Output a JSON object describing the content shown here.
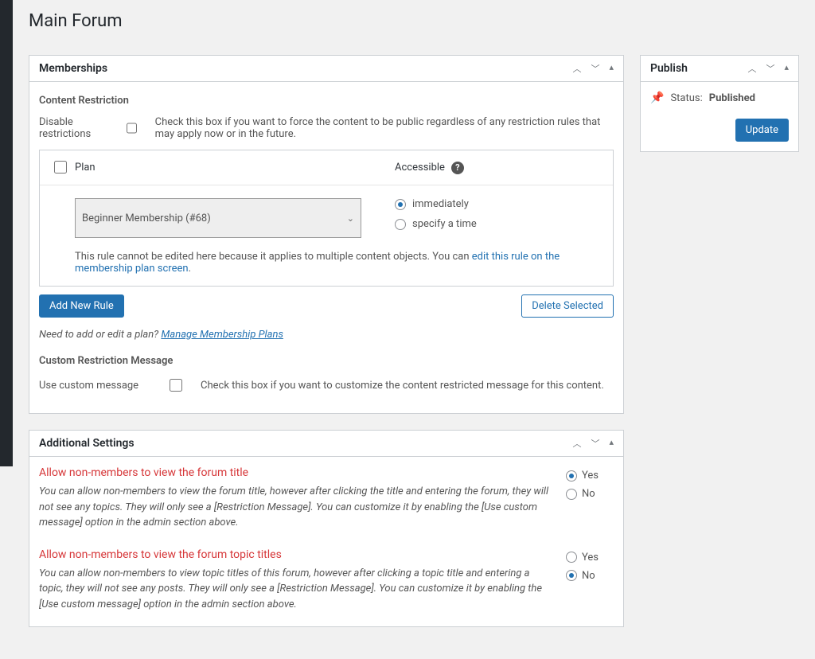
{
  "page": {
    "title": "Main Forum"
  },
  "memberships": {
    "box_title": "Memberships",
    "content_restriction_heading": "Content Restriction",
    "disable_label": "Disable restrictions",
    "disable_hint": "Check this box if you want to force the content to be public regardless of any restriction rules that may apply now or in the future.",
    "table": {
      "plan_header": "Plan",
      "access_header": "Accessible",
      "selected_plan": "Beginner Membership (#68)",
      "opt_immediately": "immediately",
      "opt_specify": "specify a time",
      "note_prefix": "This rule cannot be edited here because it applies to multiple content objects. You can ",
      "note_link": "edit this rule on the membership plan screen",
      "note_suffix": "."
    },
    "add_rule_btn": "Add New Rule",
    "delete_btn": "Delete Selected",
    "manage_prefix": "Need to add or edit a plan?",
    "manage_link": "Manage Membership Plans",
    "custom_msg_heading": "Custom Restriction Message",
    "custom_msg_label": "Use custom message",
    "custom_msg_hint": "Check this box if you want to customize the content restricted message for this content."
  },
  "additional": {
    "box_title": "Additional Settings",
    "s1_title": "Allow non-members to view the forum title",
    "s1_desc": "You can allow non-members to view the forum title, however after clicking the title and entering the forum, they will not see any topics. They will only see a [Restriction Message]. You can customize it by enabling the [Use custom message] option in the admin section above.",
    "s1_value": "yes",
    "s2_title": "Allow non-members to view the forum topic titles",
    "s2_desc": "You can allow non-members to view topic titles of this forum, however after clicking a topic title and entering a topic, they will not see any posts. They will only see a [Restriction Message]. You can customize it by enabling the [Use custom message] option in the admin section above.",
    "s2_value": "no",
    "yes_label": "Yes",
    "no_label": "No"
  },
  "publish": {
    "box_title": "Publish",
    "status_label": "Status:",
    "status_value": "Published",
    "update_btn": "Update"
  }
}
